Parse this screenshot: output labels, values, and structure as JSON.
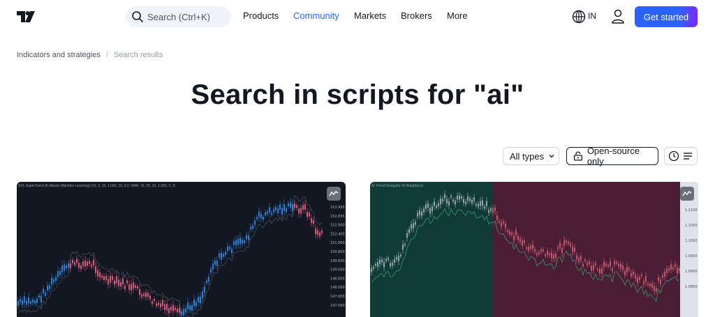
{
  "header": {
    "search_placeholder": "Search (Ctrl+K)",
    "nav": [
      "Products",
      "Community",
      "Markets",
      "Brokers",
      "More"
    ],
    "active_nav": "Community",
    "region": "IN",
    "cta_label": "Get started",
    "accent_color": "#2962ff"
  },
  "breadcrumb": {
    "parent": "Indicators and strategies",
    "current": "Search results"
  },
  "page_title": "Search in scripts for \"ai\"",
  "filters": {
    "types_label": "All types",
    "open_source_label": "Open-source only",
    "view_icons": [
      "clock-icon",
      "list-view-icon"
    ]
  },
  "cards": [
    {
      "chart_caption": "SVL SuperTrend (K-Means Machine Learning) (10, 3, 10, 1.000, 10, 3.0, SMA, 33, 20, 10, 1.000, 2, 2)",
      "price_labels": [
        "153.955",
        "152.835",
        "152.800",
        "152.400",
        "151.800",
        "150.800",
        "149.600",
        "149.000",
        "148.800",
        "148.000",
        "147.600",
        "147.000"
      ],
      "theme": "dark",
      "colors": {
        "up": "#2e7fd6",
        "down": "#d45b7a",
        "bg": "#131722"
      }
    },
    {
      "chart_caption": "AI Trend Navigator (K-Neighbors)",
      "price_labels": [
        "1.1100",
        "1.1050",
        "1.1000",
        "1.0950",
        "1.0900",
        "1.0850"
      ],
      "theme": "teal-magenta",
      "colors": {
        "bull_zone": "#103a35",
        "bear_zone": "#4a1d35",
        "up": "#b5c0c8",
        "down": "#e06a7a",
        "ma": "#3fa876"
      }
    }
  ]
}
